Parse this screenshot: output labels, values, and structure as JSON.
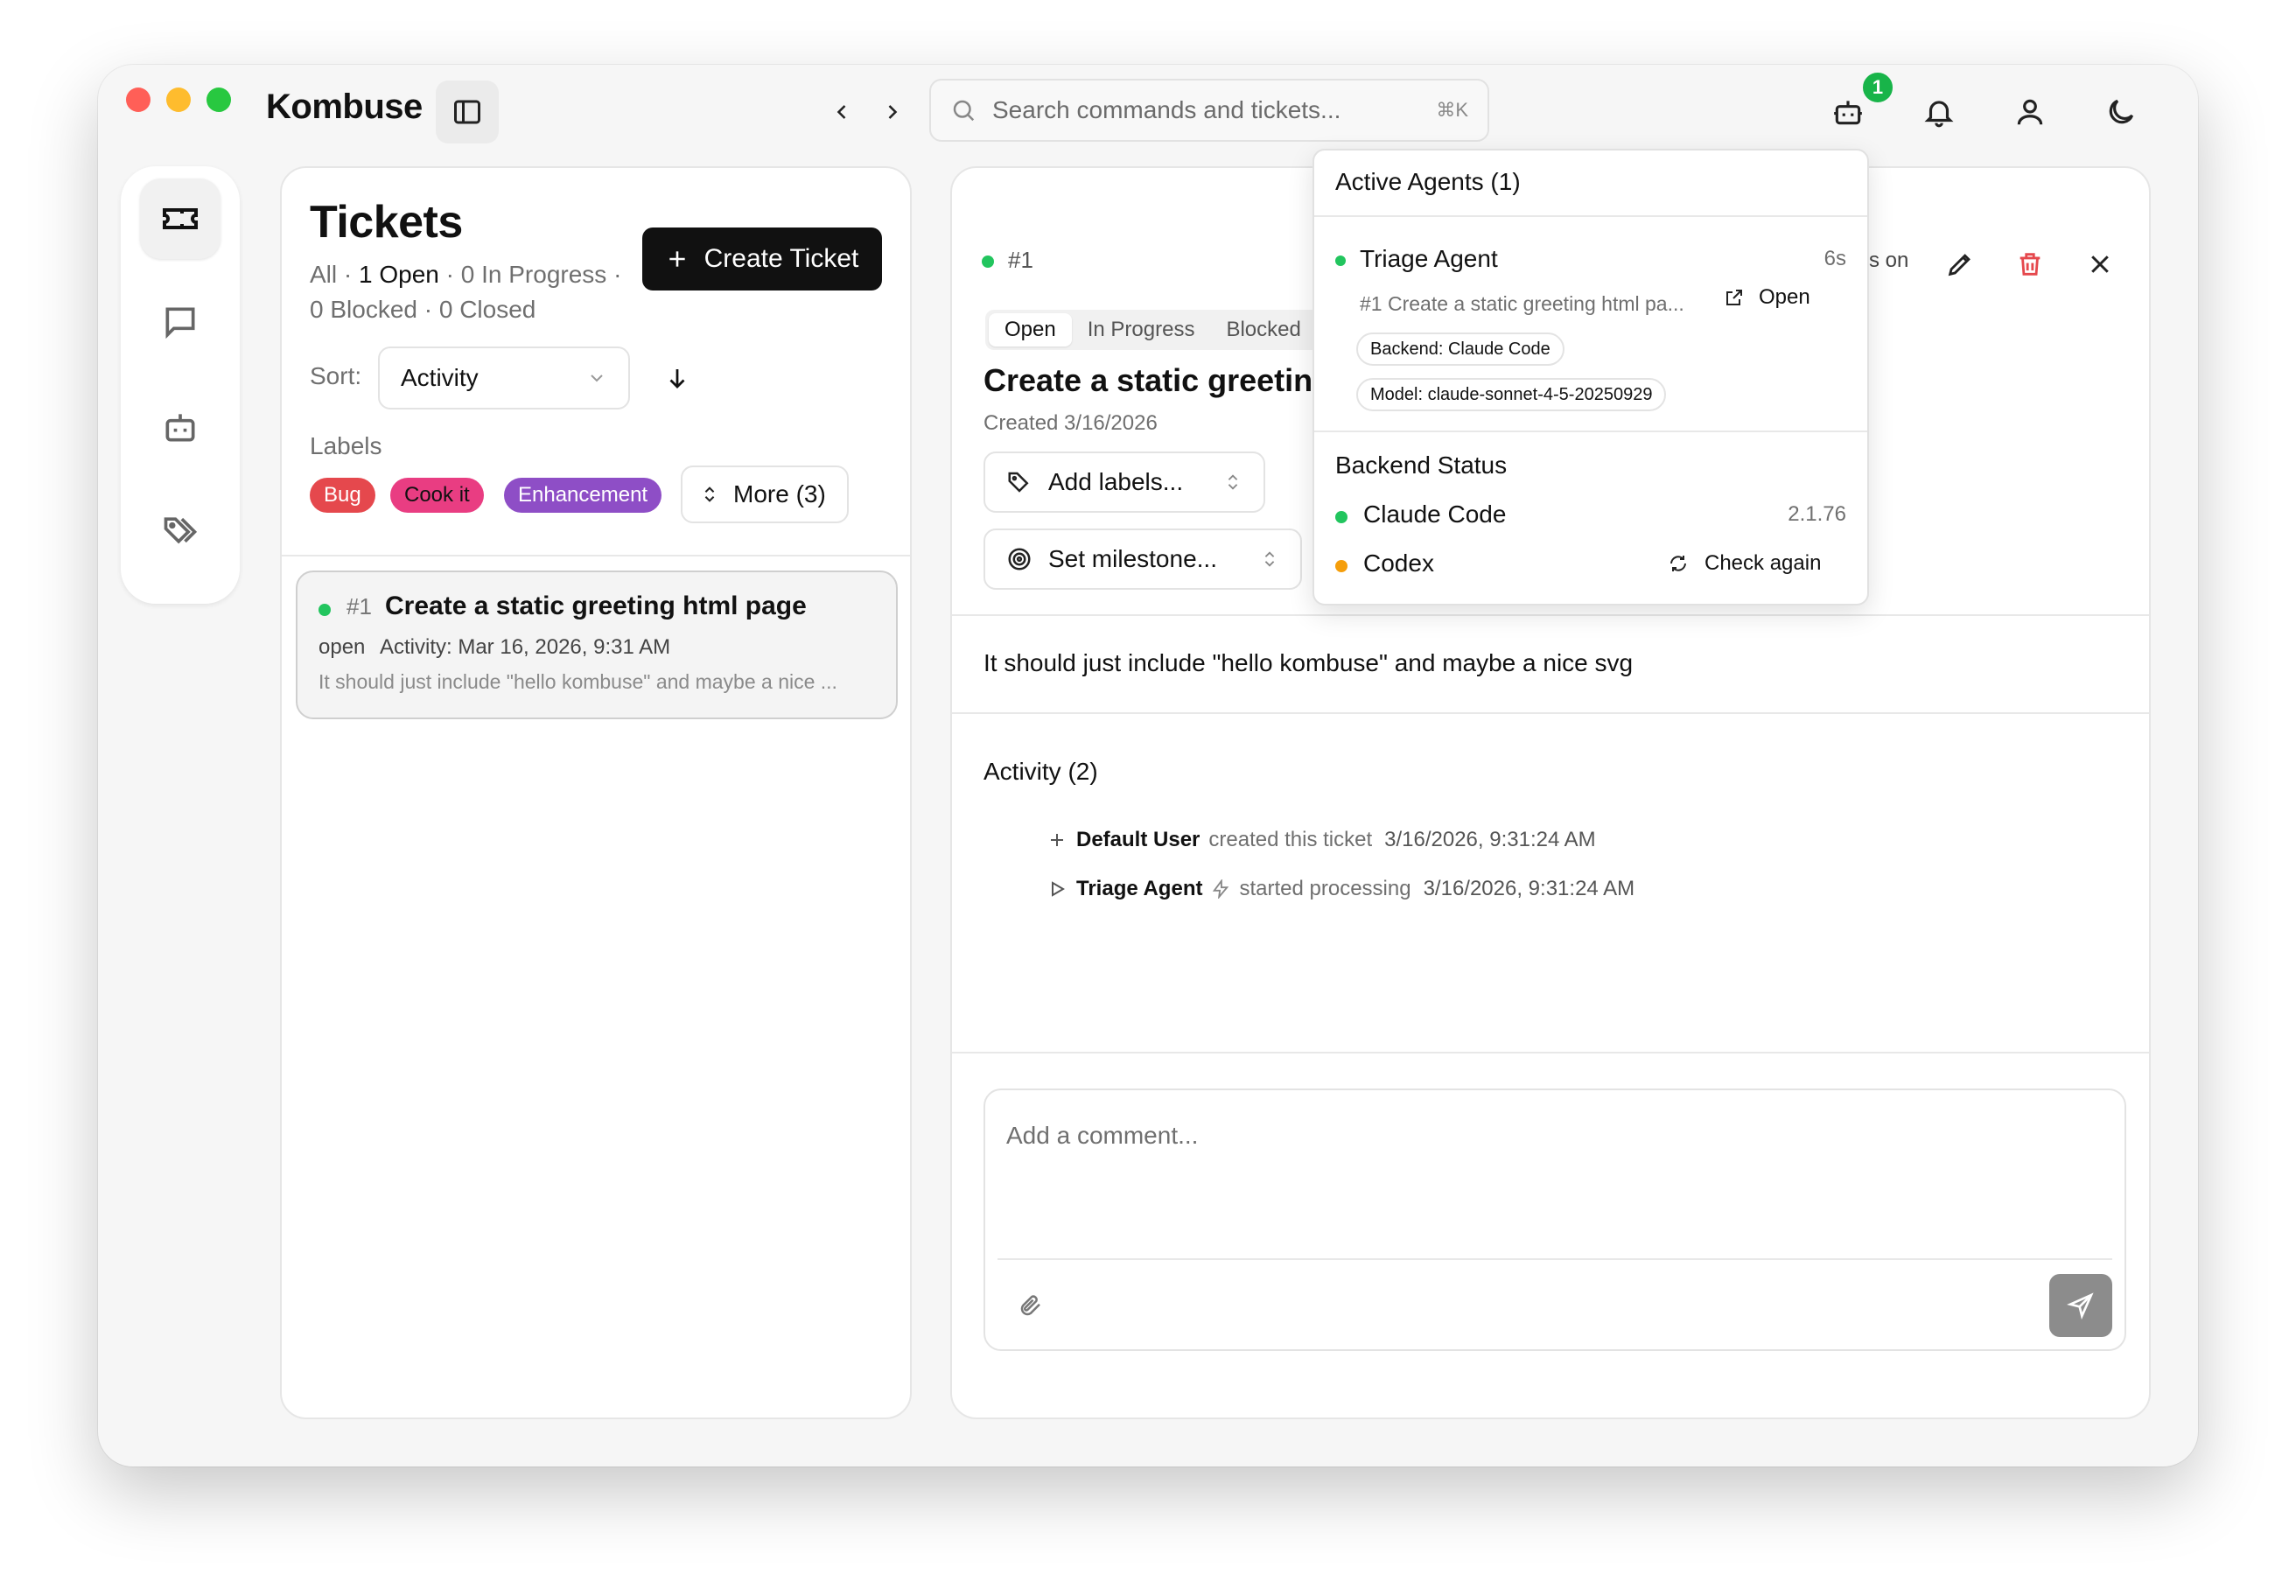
{
  "app": {
    "title": "Kombuse"
  },
  "search": {
    "placeholder": "Search commands and tickets...",
    "shortcut": "⌘K"
  },
  "header": {
    "agent_badge_count": "1"
  },
  "tickets_panel": {
    "title": "Tickets",
    "create_button": "Create Ticket",
    "filters": {
      "all": "All",
      "sep1": "·",
      "open": "1 Open",
      "sep2": "·",
      "in_progress": "0 In Progress",
      "sep3": "·",
      "blocked": "0 Blocked",
      "sep4": "·",
      "closed": "0 Closed"
    },
    "sort_label": "Sort:",
    "sort_value": "Activity",
    "labels_heading": "Labels",
    "labels": [
      {
        "name": "Bug",
        "color": "#e5484d"
      },
      {
        "name": "Cook it",
        "color": "#e93d82"
      },
      {
        "name": "Enhancement",
        "color": "#8e4ec6"
      }
    ],
    "more_labels": "More (3)"
  },
  "ticket_list": [
    {
      "number": "#1",
      "title": "Create a static greeting html page",
      "status": "open",
      "activity": "Activity: Mar 16, 2026, 9:31 AM",
      "preview": "It should just include \"hello kombuse\" and maybe a nice ..."
    }
  ],
  "detail": {
    "number": "#1",
    "tabs": [
      "Open",
      "In Progress",
      "Blocked"
    ],
    "title": "Create a static greeting",
    "created": "Created 3/16/2026",
    "add_labels": "Add labels...",
    "set_milestone": "Set milestone...",
    "partial_text": "s on",
    "description": "It should just include \"hello kombuse\" and maybe a nice svg",
    "activity_heading": "Activity (2)",
    "activity": [
      {
        "actor": "Default User",
        "action": "created this ticket",
        "time": "3/16/2026, 9:31:24 AM"
      },
      {
        "actor": "Triage Agent",
        "action": "started processing",
        "time": "3/16/2026, 9:31:24 AM"
      }
    ],
    "comment_placeholder": "Add a comment..."
  },
  "agents_dropdown": {
    "heading": "Active Agents (1)",
    "agent": {
      "name": "Triage Agent",
      "elapsed": "6s",
      "task": "#1 Create a static greeting html pa...",
      "open_label": "Open",
      "backend_chip": "Backend: Claude Code",
      "model_chip": "Model: claude-sonnet-4-5-20250929"
    },
    "backend_heading": "Backend Status",
    "backends": [
      {
        "name": "Claude Code",
        "version": "2.1.76",
        "status_color": "#22c55e"
      },
      {
        "name": "Codex",
        "action": "Check again",
        "status_color": "#f59e0b"
      }
    ]
  },
  "colors": {
    "accent_green": "#22c55e",
    "danger_red": "#e5484d",
    "dark": "#111111"
  }
}
